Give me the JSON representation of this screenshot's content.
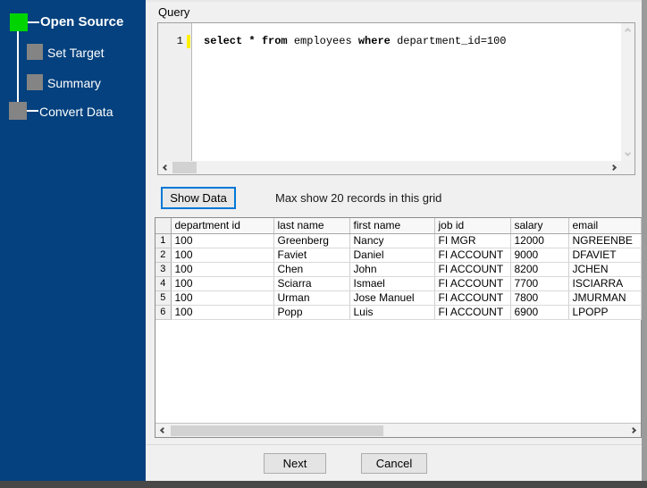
{
  "colors": {
    "accent": "#0078D7",
    "sidebar_bg": "#04417E",
    "step_active": "#00D400",
    "step_pending": "#848484",
    "modified_line_marker": "#FFF000"
  },
  "sidebar": {
    "steps": [
      {
        "label": "Open Source",
        "state": "active"
      },
      {
        "label": "Set Target",
        "state": "pending"
      },
      {
        "label": "Summary",
        "state": "pending"
      },
      {
        "label": "Convert Data",
        "state": "pending"
      }
    ]
  },
  "query": {
    "panel_label": "Query",
    "line_number": "1",
    "sql_tokens": [
      {
        "text": "select ",
        "bold": true
      },
      {
        "text": "* ",
        "bold": true
      },
      {
        "text": "from ",
        "bold": true
      },
      {
        "text": "employees ",
        "bold": false
      },
      {
        "text": "where ",
        "bold": true
      },
      {
        "text": "department_id=100",
        "bold": false
      }
    ]
  },
  "toolbar": {
    "show_data_label": "Show Data",
    "note": "Max show 20 records in this grid"
  },
  "grid": {
    "columns": [
      "department id",
      "last name",
      "first name",
      "job id",
      "salary",
      "email"
    ],
    "rows": [
      {
        "num": "1",
        "cells": [
          "100",
          "Greenberg",
          "Nancy",
          "FI MGR",
          "12000",
          "NGREENBE"
        ]
      },
      {
        "num": "2",
        "cells": [
          "100",
          "Faviet",
          "Daniel",
          "FI ACCOUNT",
          "9000",
          "DFAVIET"
        ]
      },
      {
        "num": "3",
        "cells": [
          "100",
          "Chen",
          "John",
          "FI ACCOUNT",
          "8200",
          "JCHEN"
        ]
      },
      {
        "num": "4",
        "cells": [
          "100",
          "Sciarra",
          "Ismael",
          "FI ACCOUNT",
          "7700",
          "ISCIARRA"
        ]
      },
      {
        "num": "5",
        "cells": [
          "100",
          "Urman",
          "Jose Manuel",
          "FI ACCOUNT",
          "7800",
          "JMURMAN"
        ]
      },
      {
        "num": "6",
        "cells": [
          "100",
          "Popp",
          "Luis",
          "FI ACCOUNT",
          "6900",
          "LPOPP"
        ]
      }
    ]
  },
  "footer": {
    "next_label": "Next",
    "cancel_label": "Cancel"
  }
}
